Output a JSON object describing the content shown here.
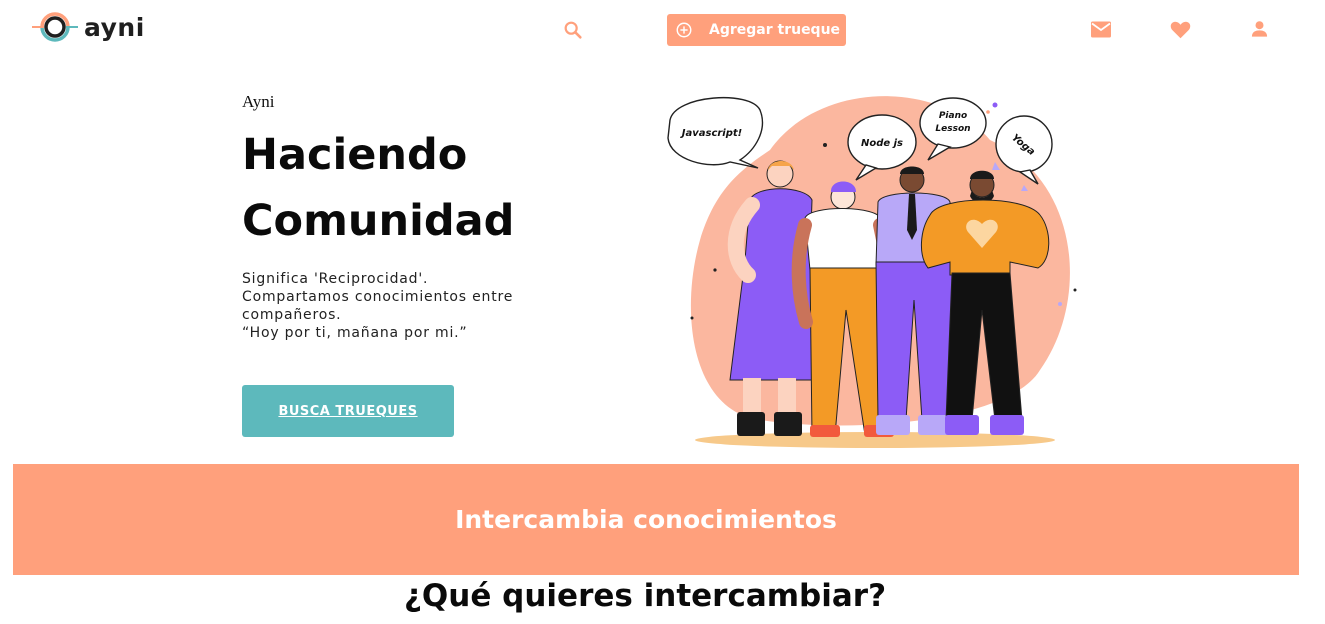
{
  "brand": {
    "name": "ayni"
  },
  "header": {
    "add_label": "Agregar trueque",
    "icons": {
      "search": "search-icon",
      "add": "plus-circle-icon",
      "mail": "mail-icon",
      "favorites": "heart-icon",
      "profile": "user-icon"
    }
  },
  "hero": {
    "eyebrow": "Ayni",
    "title_line1": "Haciendo",
    "title_line2": "Comunidad",
    "desc_line1": "Significa 'Reciprocidad'.",
    "desc_line2": "Compartamos conocimientos entre",
    "desc_line3": "compañeros.",
    "desc_line4": "“Hoy por ti, mañana por mi.”",
    "cta_label": "BUSCA TRUEQUES"
  },
  "illustration": {
    "bubbles": [
      "Javascript!",
      "Node js",
      "Piano",
      "Lesson",
      "Yoga"
    ]
  },
  "banner": {
    "text": "Intercambia conocimientos"
  },
  "section": {
    "title": "¿Qué quieres intercambiar?"
  },
  "colors": {
    "accent": "#ffa07c",
    "teal": "#5db9bc",
    "text": "#0a0a0a",
    "purple": "#8c5cf6",
    "orange": "#f39a26"
  }
}
